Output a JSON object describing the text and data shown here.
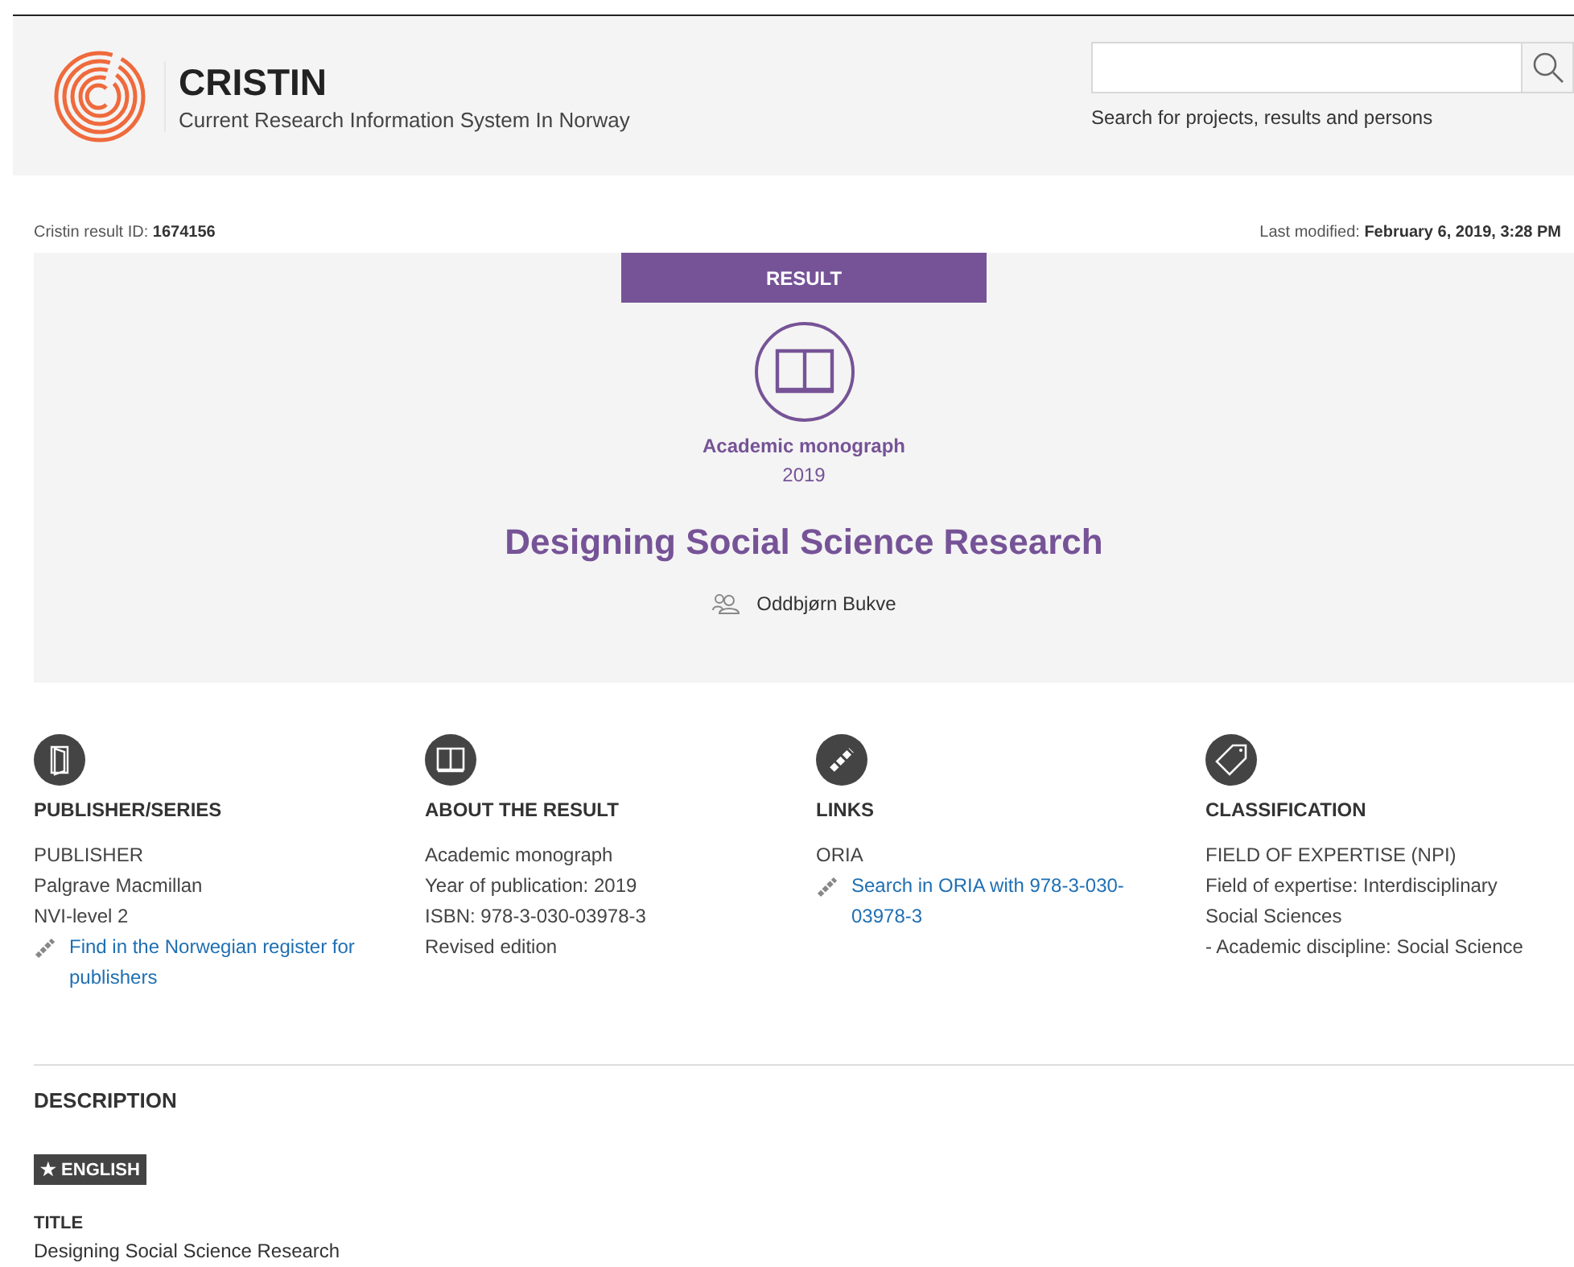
{
  "header": {
    "logo_title": "CRISTIN",
    "logo_subtitle": "Current Research Information System In Norway",
    "search": {
      "hint": "Search for projects, results and persons"
    }
  },
  "meta": {
    "id_label": "Cristin result ID: ",
    "id_value": "1674156",
    "modified_label": "Last modified: ",
    "modified_value": "February 6, 2019, 3:28 PM"
  },
  "result": {
    "badge": "RESULT",
    "category": "Academic monograph",
    "year": "2019",
    "title": "Designing Social Science Research",
    "author": "Oddbjørn Bukve"
  },
  "columns": [
    {
      "heading": "PUBLISHER/SERIES",
      "lines": [
        {
          "kind": "text",
          "text": "PUBLISHER"
        },
        {
          "kind": "text",
          "text": "Palgrave Macmillan"
        },
        {
          "kind": "text",
          "text": "NVI-level 2"
        },
        {
          "kind": "link",
          "text": "Find in the Norwegian register for publishers"
        }
      ]
    },
    {
      "heading": "ABOUT THE RESULT",
      "lines": [
        {
          "kind": "text",
          "text": "Academic monograph"
        },
        {
          "kind": "text",
          "text": "Year of publication: 2019"
        },
        {
          "kind": "text",
          "text": "ISBN: 978-3-030-03978-3"
        },
        {
          "kind": "text",
          "text": "Revised edition"
        }
      ]
    },
    {
      "heading": "LINKS",
      "lines": [
        {
          "kind": "text",
          "text": "ORIA"
        },
        {
          "kind": "link",
          "text": "Search in ORIA with 978-3-030-03978-3"
        }
      ]
    },
    {
      "heading": "CLASSIFICATION",
      "lines": [
        {
          "kind": "text",
          "text": "FIELD OF EXPERTISE (NPI)"
        },
        {
          "kind": "text",
          "text": "Field of expertise: Interdisciplinary Social Sciences"
        },
        {
          "kind": "text",
          "text": "- Academic discipline: Social Science"
        }
      ]
    }
  ],
  "description": {
    "heading": "DESCRIPTION",
    "language": "★ ENGLISH",
    "title_label": "TITLE",
    "title_value": "Designing Social Science Research"
  }
}
